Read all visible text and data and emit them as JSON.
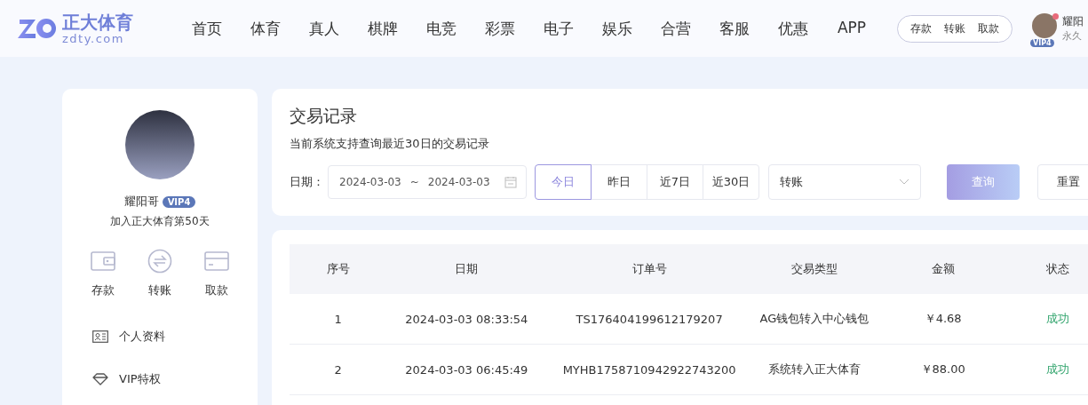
{
  "header": {
    "brand": {
      "name": "正大体育",
      "domain": "zdty.com"
    },
    "nav": [
      {
        "label": "首页",
        "selected": false
      },
      {
        "label": "体育",
        "selected": false
      },
      {
        "label": "真人",
        "selected": false
      },
      {
        "label": "棋牌",
        "selected": false
      },
      {
        "label": "电竞",
        "selected": false
      },
      {
        "label": "彩票",
        "selected": false
      },
      {
        "label": "电子",
        "selected": false
      },
      {
        "label": "娱乐",
        "selected": false
      },
      {
        "label": "合营",
        "selected": false
      },
      {
        "label": "客服",
        "selected": false
      },
      {
        "label": "优惠",
        "selected": false
      },
      {
        "label": "APP",
        "selected": false
      }
    ],
    "wallet_links": [
      "存款",
      "转账",
      "取款"
    ],
    "user": {
      "vip_badge": "VIP4",
      "name": "耀阳",
      "subtitle": "永久",
      "has_notification": true
    }
  },
  "profile": {
    "name": "耀阳哥",
    "vip_badge": "VIP4",
    "joined": "加入正大体育第50天",
    "actions": [
      {
        "kind": "wallet",
        "label": "存款"
      },
      {
        "kind": "transfer",
        "label": "转账"
      },
      {
        "kind": "card",
        "label": "取款"
      }
    ],
    "menu": [
      {
        "kind": "id-card",
        "label": "个人资料"
      },
      {
        "kind": "diamond",
        "label": "VIP特权"
      }
    ]
  },
  "records": {
    "title": "交易记录",
    "subtitle": "当前系统支持查询最近30日的交易记录",
    "filter": {
      "date_label": "日期：",
      "date_start": "2024-03-03",
      "date_separator": "~",
      "date_end": "2024-03-03",
      "quick_ranges": [
        {
          "label": "今日",
          "selected": true
        },
        {
          "label": "昨日",
          "selected": false
        },
        {
          "label": "近7日",
          "selected": false
        },
        {
          "label": "近30日",
          "selected": false
        }
      ],
      "type_value": "转账",
      "query_button": "查询",
      "reset_button": "重置"
    },
    "table": {
      "columns": [
        "序号",
        "日期",
        "订单号",
        "交易类型",
        "金额",
        "状态"
      ],
      "rows": [
        {
          "cells": [
            "1",
            "2024-03-03 08:33:54",
            "TS176404199612179207",
            "AG钱包转入中心钱包",
            "￥4.68"
          ],
          "status": {
            "text": "成功",
            "kind": "success"
          }
        },
        {
          "cells": [
            "2",
            "2024-03-03 06:45:49",
            "MYHB1758710942922743200",
            "系统转入正大体育",
            "￥88.00"
          ],
          "status": {
            "text": "成功",
            "kind": "success"
          }
        }
      ]
    }
  }
}
